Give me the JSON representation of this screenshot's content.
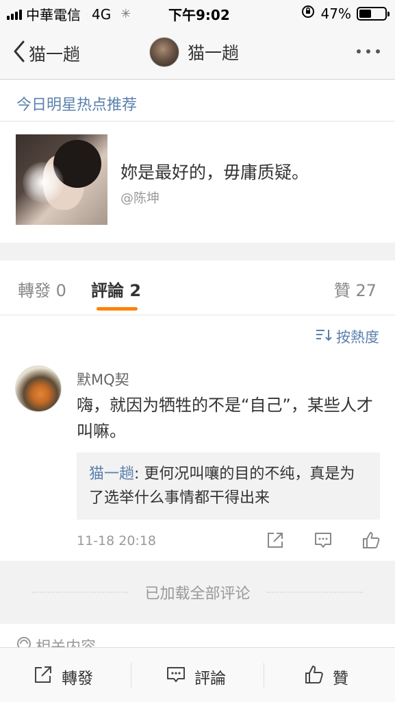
{
  "status_bar": {
    "carrier": "中華電信",
    "network": "4G",
    "time": "下午9:02",
    "battery": "47%",
    "battery_level": 0.47
  },
  "nav": {
    "back_label": "猫一趟",
    "title": "猫一趟"
  },
  "hot": {
    "header": "今日明星热点推荐",
    "card_title": "妳是最好的，毋庸质疑。",
    "card_author": "@陈坤"
  },
  "tabs": {
    "forward": "轉發 0",
    "comment": "評論 2",
    "like": "贊 27"
  },
  "sort_label": "按熱度",
  "comment": {
    "user": "默MQ契",
    "text": "嗨，就因为牺牲的不是“自己”，某些人才叫嘛。",
    "reply_user": "猫一趟",
    "reply_sep": ": ",
    "reply_text": "更何况叫嚷的目的不纯，真是为了选举什么事情都干得出来",
    "time": "11-18 20:18"
  },
  "loaded_text": "已加载全部评论",
  "related_label": "相关内容",
  "bottom": {
    "forward": "轉發",
    "comment": "評論",
    "like": "贊"
  },
  "colors": {
    "link_blue": "#5a7fad",
    "accent_orange": "#ff8200"
  }
}
